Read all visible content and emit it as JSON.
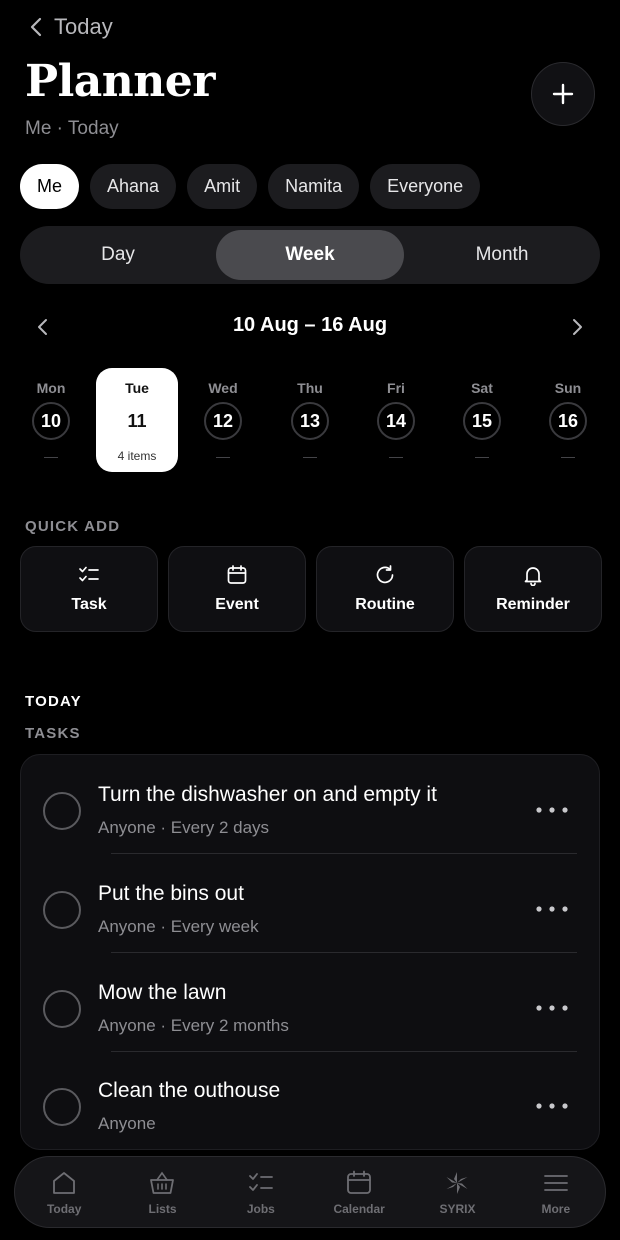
{
  "header": {
    "back_label": "Today",
    "title": "Planner",
    "subtitle": "Me · Today"
  },
  "people_filters": [
    {
      "label": "Me",
      "active": true
    },
    {
      "label": "Ahana",
      "active": false
    },
    {
      "label": "Amit",
      "active": false
    },
    {
      "label": "Namita",
      "active": false
    },
    {
      "label": "Everyone",
      "active": false
    }
  ],
  "view_modes": [
    {
      "label": "Day",
      "active": false
    },
    {
      "label": "Week",
      "active": true
    },
    {
      "label": "Month",
      "active": false
    }
  ],
  "week": {
    "range_label": "10 Aug – 16 Aug",
    "days": [
      {
        "dow": "Mon",
        "date": "10",
        "marker": "—",
        "selected": false
      },
      {
        "dow": "Tue",
        "date": "11",
        "marker": "4 items",
        "selected": true
      },
      {
        "dow": "Wed",
        "date": "12",
        "marker": "—",
        "selected": false
      },
      {
        "dow": "Thu",
        "date": "13",
        "marker": "—",
        "selected": false
      },
      {
        "dow": "Fri",
        "date": "14",
        "marker": "—",
        "selected": false
      },
      {
        "dow": "Sat",
        "date": "15",
        "marker": "—",
        "selected": false
      },
      {
        "dow": "Sun",
        "date": "16",
        "marker": "—",
        "selected": false
      }
    ]
  },
  "quick_add": {
    "label": "QUICK ADD",
    "items": [
      {
        "label": "Task",
        "icon": "task-list-icon"
      },
      {
        "label": "Event",
        "icon": "calendar-icon"
      },
      {
        "label": "Routine",
        "icon": "refresh-icon"
      },
      {
        "label": "Reminder",
        "icon": "bell-icon"
      }
    ]
  },
  "today": {
    "label": "TODAY",
    "tasks_label": "TASKS",
    "tasks": [
      {
        "title": "Turn the dishwasher on and empty it",
        "subtitle": "Anyone · Every 2 days"
      },
      {
        "title": "Put the bins out",
        "subtitle": "Anyone · Every week"
      },
      {
        "title": "Mow the lawn",
        "subtitle": "Anyone · Every 2 months"
      },
      {
        "title": "Clean the outhouse",
        "subtitle": "Anyone"
      }
    ]
  },
  "tabbar": [
    {
      "label": "Today",
      "icon": "home-icon"
    },
    {
      "label": "Lists",
      "icon": "basket-icon"
    },
    {
      "label": "Jobs",
      "icon": "checklist-icon"
    },
    {
      "label": "Calendar",
      "icon": "calendar-icon"
    },
    {
      "label": "SYRIX",
      "icon": "syrix-logo-icon"
    },
    {
      "label": "More",
      "icon": "menu-icon"
    }
  ],
  "colors": {
    "background": "#000000",
    "surface": "#1c1c1f",
    "card": "#0e0e11",
    "muted_text": "#8e8e93",
    "active_chip": "#ffffff",
    "active_segment": "#4a4a4e"
  }
}
